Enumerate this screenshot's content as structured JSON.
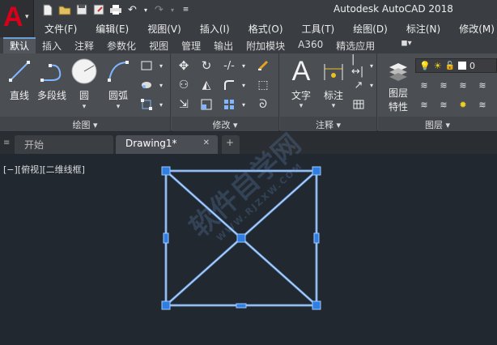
{
  "title_bar": {
    "app_title": "Autodesk AutoCAD 2018"
  },
  "app_button": {
    "letter": "A"
  },
  "menu": [
    "文件(F)",
    "编辑(E)",
    "视图(V)",
    "插入(I)",
    "格式(O)",
    "工具(T)",
    "绘图(D)",
    "标注(N)",
    "修改(M)"
  ],
  "ribbon_tabs": [
    "默认",
    "插入",
    "注释",
    "参数化",
    "视图",
    "管理",
    "输出",
    "附加模块",
    "A360",
    "精选应用"
  ],
  "panels": {
    "draw": {
      "title": "绘图 ▾",
      "line": "直线",
      "polyline": "多段线",
      "circle": "圆",
      "arc": "圆弧"
    },
    "modify": {
      "title": "修改 ▾"
    },
    "annotation": {
      "title": "注释 ▾",
      "text": "文字",
      "dimension": "标注"
    },
    "layers": {
      "title": "图层 ▾",
      "properties_line1": "图层",
      "properties_line2": "特性",
      "layer_name": "0"
    }
  },
  "file_tabs": {
    "start": "开始",
    "drawing": "Drawing1*",
    "close": "✕",
    "add": "+"
  },
  "viewport_label": "[−][俯视][二维线框]",
  "watermark": {
    "main": "软件自学网",
    "sub": "WWW.RJZXW.COM"
  },
  "colors": {
    "accent": "#6a9fd4",
    "cad_red": "#d9001b",
    "selection_line": "#6aa3e8",
    "grip": "#2f7fe3"
  }
}
